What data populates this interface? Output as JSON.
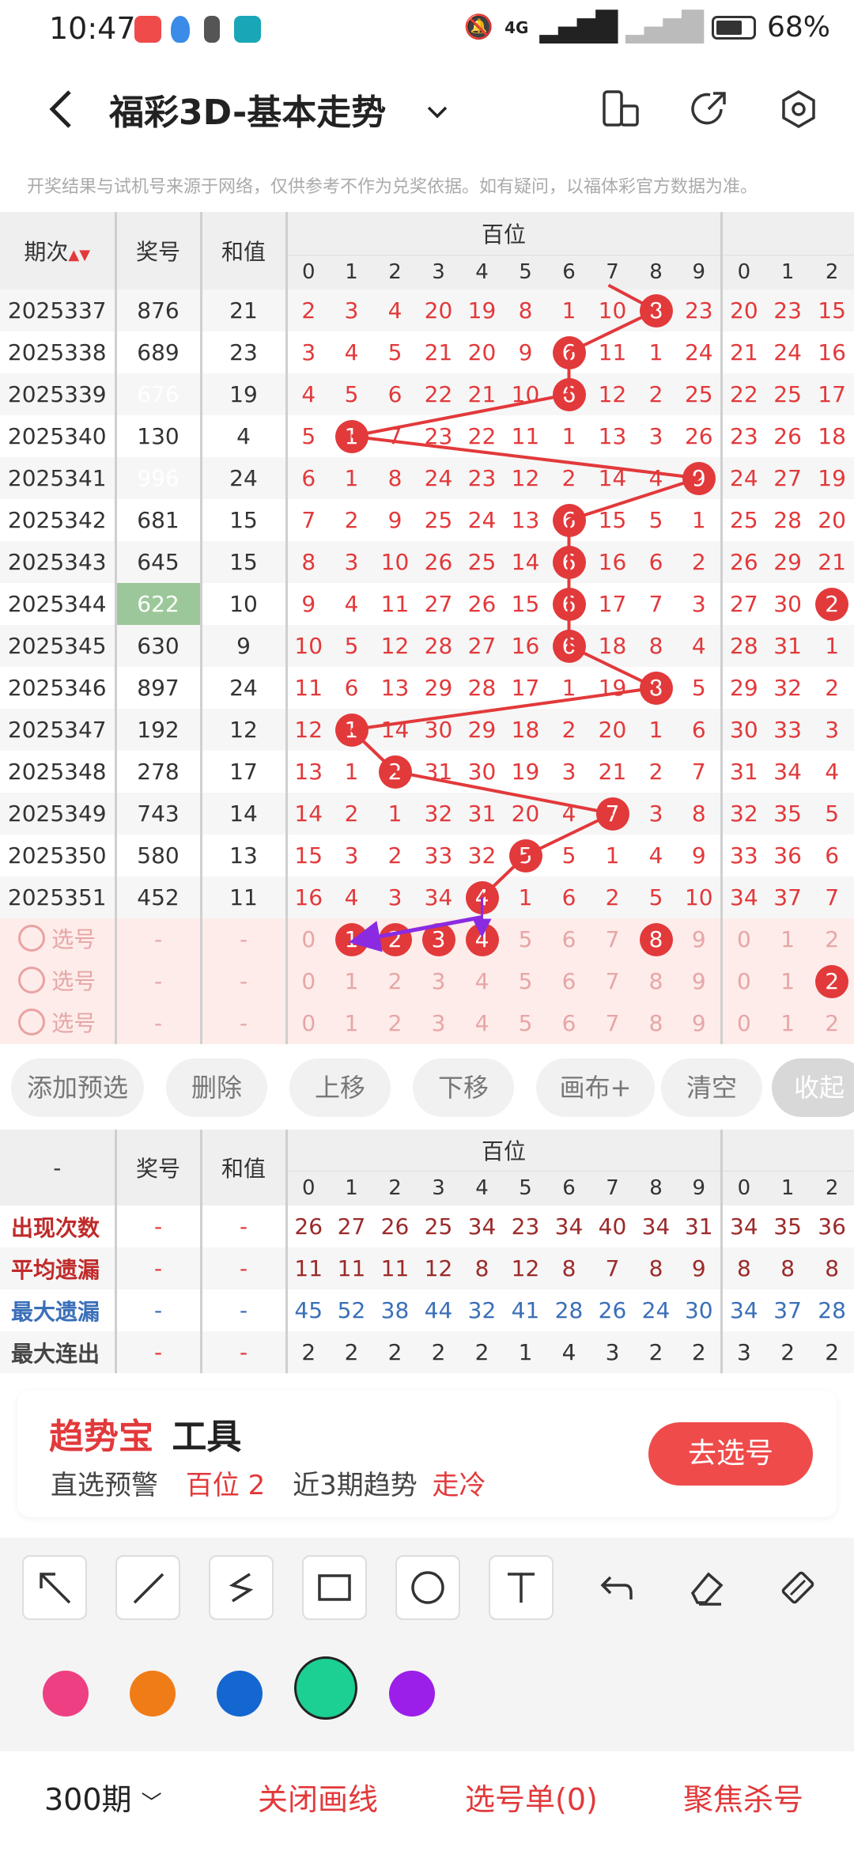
{
  "status": {
    "time": "10:47",
    "battery": "68%",
    "network": "4G"
  },
  "header": {
    "title": "福彩3D-基本走势"
  },
  "notice": "开奖结果与试机号来源于网络，仅供参考不作为兑奖依据。如有疑问，以福体彩官方数据为准。",
  "table": {
    "col_period": "期次",
    "col_award": "奖号",
    "col_sum": "和值",
    "group_hundreds": "百位",
    "digits": [
      "0",
      "1",
      "2",
      "3",
      "4",
      "5",
      "6",
      "7",
      "8",
      "9"
    ],
    "tens_digits": [
      "0",
      "1",
      "2"
    ],
    "rows": [
      {
        "period": "2025337",
        "award": "876",
        "sum": "21",
        "h": [
          "2",
          "3",
          "4",
          "20",
          "19",
          "8",
          "1",
          "10",
          "8",
          "23"
        ],
        "t": [
          "20",
          "23",
          "15"
        ]
      },
      {
        "period": "2025338",
        "award": "689",
        "sum": "23",
        "h": [
          "3",
          "4",
          "5",
          "21",
          "20",
          "9",
          "6",
          "11",
          "1",
          "24"
        ],
        "t": [
          "21",
          "24",
          "16"
        ]
      },
      {
        "period": "2025339",
        "award": "676",
        "sum": "19",
        "h": [
          "4",
          "5",
          "6",
          "22",
          "21",
          "10",
          "6",
          "12",
          "2",
          "25"
        ],
        "t": [
          "22",
          "25",
          "17"
        ]
      },
      {
        "period": "2025340",
        "award": "130",
        "sum": "4",
        "h": [
          "5",
          "1",
          "7",
          "23",
          "22",
          "11",
          "1",
          "13",
          "3",
          "26"
        ],
        "t": [
          "23",
          "26",
          "18"
        ]
      },
      {
        "period": "2025341",
        "award": "996",
        "sum": "24",
        "h": [
          "6",
          "1",
          "8",
          "24",
          "23",
          "12",
          "2",
          "14",
          "4",
          "9"
        ],
        "t": [
          "24",
          "27",
          "19"
        ]
      },
      {
        "period": "2025342",
        "award": "681",
        "sum": "15",
        "h": [
          "7",
          "2",
          "9",
          "25",
          "24",
          "13",
          "6",
          "15",
          "5",
          "1"
        ],
        "t": [
          "25",
          "28",
          "20"
        ]
      },
      {
        "period": "2025343",
        "award": "645",
        "sum": "15",
        "h": [
          "8",
          "3",
          "10",
          "26",
          "25",
          "14",
          "6",
          "16",
          "6",
          "2"
        ],
        "t": [
          "26",
          "29",
          "21"
        ]
      },
      {
        "period": "2025344",
        "award": "622",
        "sum": "10",
        "h": [
          "9",
          "4",
          "11",
          "27",
          "26",
          "15",
          "6",
          "17",
          "7",
          "3"
        ],
        "t": [
          "27",
          "30",
          "2"
        ]
      },
      {
        "period": "2025345",
        "award": "630",
        "sum": "9",
        "h": [
          "10",
          "5",
          "12",
          "28",
          "27",
          "16",
          "6",
          "18",
          "8",
          "4"
        ],
        "t": [
          "28",
          "31",
          "1"
        ]
      },
      {
        "period": "2025346",
        "award": "897",
        "sum": "24",
        "h": [
          "11",
          "6",
          "13",
          "29",
          "28",
          "17",
          "1",
          "19",
          "8",
          "5"
        ],
        "t": [
          "29",
          "32",
          "2"
        ]
      },
      {
        "period": "2025347",
        "award": "192",
        "sum": "12",
        "h": [
          "12",
          "1",
          "14",
          "30",
          "29",
          "18",
          "2",
          "20",
          "1",
          "6"
        ],
        "t": [
          "30",
          "33",
          "3"
        ]
      },
      {
        "period": "2025348",
        "award": "278",
        "sum": "17",
        "h": [
          "13",
          "1",
          "2",
          "31",
          "30",
          "19",
          "3",
          "21",
          "2",
          "7"
        ],
        "t": [
          "31",
          "34",
          "4"
        ]
      },
      {
        "period": "2025349",
        "award": "743",
        "sum": "14",
        "h": [
          "14",
          "2",
          "1",
          "32",
          "31",
          "20",
          "4",
          "7",
          "3",
          "8"
        ],
        "t": [
          "32",
          "35",
          "5"
        ]
      },
      {
        "period": "2025350",
        "award": "580",
        "sum": "13",
        "h": [
          "15",
          "3",
          "2",
          "33",
          "32",
          "5",
          "5",
          "1",
          "4",
          "9"
        ],
        "t": [
          "33",
          "36",
          "6"
        ]
      },
      {
        "period": "2025351",
        "award": "452",
        "sum": "11",
        "h": [
          "16",
          "4",
          "3",
          "34",
          "4",
          "1",
          "6",
          "2",
          "5",
          "10"
        ],
        "t": [
          "34",
          "37",
          "7"
        ]
      }
    ],
    "select_label": "选号",
    "dash": "-"
  },
  "buttons": [
    "添加预选",
    "删除",
    "上移",
    "下移",
    "画布+",
    "清空",
    "收起"
  ],
  "stats": {
    "col_label": "-",
    "col_award": "奖号",
    "col_sum": "和值",
    "group": "百位",
    "rows": [
      {
        "label": "出现次数",
        "vals": [
          "26",
          "27",
          "26",
          "25",
          "34",
          "23",
          "34",
          "40",
          "34",
          "31",
          "34",
          "35",
          "36"
        ]
      },
      {
        "label": "平均遗漏",
        "vals": [
          "11",
          "11",
          "11",
          "12",
          "8",
          "12",
          "8",
          "7",
          "8",
          "9",
          "8",
          "8",
          "8"
        ]
      },
      {
        "label": "最大遗漏",
        "vals": [
          "45",
          "52",
          "38",
          "44",
          "32",
          "41",
          "28",
          "26",
          "24",
          "30",
          "34",
          "37",
          "28"
        ]
      },
      {
        "label": "最大连出",
        "vals": [
          "2",
          "2",
          "2",
          "2",
          "2",
          "1",
          "4",
          "3",
          "2",
          "2",
          "3",
          "2",
          "2"
        ]
      }
    ]
  },
  "tool": {
    "brand": "趋势宝",
    "brand_suffix": "工具",
    "warn": "直选预警",
    "warn_pos": "百位 2",
    "trend": "近3期趋势",
    "trend_val": "走冷",
    "action": "去选号"
  },
  "colors": [
    "#ee3f83",
    "#f07c18",
    "#1466d0",
    "#1ccf93",
    "#9b1fe8"
  ],
  "bottom": {
    "periods": "300期",
    "close": "关闭画线",
    "list": "选号单(0)",
    "focus": "聚焦杀号"
  }
}
